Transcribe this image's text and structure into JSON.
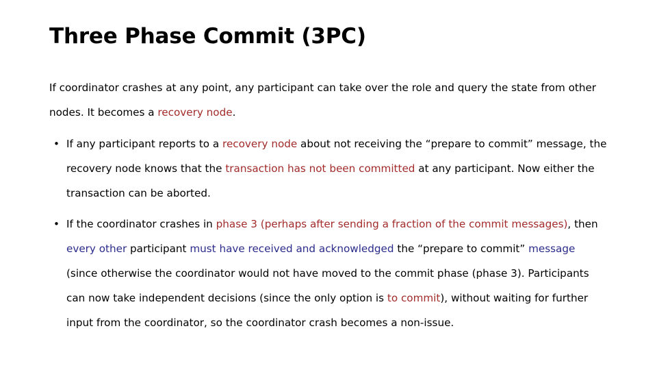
{
  "slide": {
    "title": "Three Phase Commit (3PC)",
    "intro_paragraph": {
      "segments": [
        {
          "text": "If coordinator crashes at any point, any participant can take over the role and query the state from other nodes. It becomes a ",
          "color": "black"
        },
        {
          "text": "recovery node",
          "color": "red"
        },
        {
          "text": ".",
          "color": "black"
        }
      ]
    },
    "bullets": [
      {
        "marker": "•",
        "segments": [
          {
            "text": "If any participant reports to a ",
            "color": "black"
          },
          {
            "text": "recovery node",
            "color": "red"
          },
          {
            "text": " about not receiving the “prepare to commit” message, the recovery node knows that the ",
            "color": "black"
          },
          {
            "text": "transaction has not been committed",
            "color": "red"
          },
          {
            "text": " at any participant. Now either the transaction can be aborted.",
            "color": "black"
          }
        ]
      },
      {
        "marker": "•",
        "segments": [
          {
            "text": "If the coordinator crashes in ",
            "color": "black"
          },
          {
            "text": "phase 3 (perhaps after sending a fraction of the commit messages)",
            "color": "red"
          },
          {
            "text": ", then ",
            "color": "black"
          },
          {
            "text": "every other",
            "color": "blue"
          },
          {
            "text": " participant ",
            "color": "black"
          },
          {
            "text": "must have received and acknowledged",
            "color": "blue"
          },
          {
            "text": " the “prepare to commit” ",
            "color": "black"
          },
          {
            "text": "message",
            "color": "blue"
          },
          {
            "text": " (since otherwise the coordinator would not have moved to the commit phase (phase 3). Participants can now take independent decisions (since the only option is ",
            "color": "black"
          },
          {
            "text": "to commit",
            "color": "red"
          },
          {
            "text": "), without waiting for further input from the coordinator, so the coordinator crash becomes a non-issue.",
            "color": "black"
          }
        ]
      }
    ],
    "colors": {
      "text": "#000000",
      "highlight_red": "#A32B2B",
      "highlight_blue": "#2B2B8C",
      "background": "#FFFFFF"
    }
  }
}
